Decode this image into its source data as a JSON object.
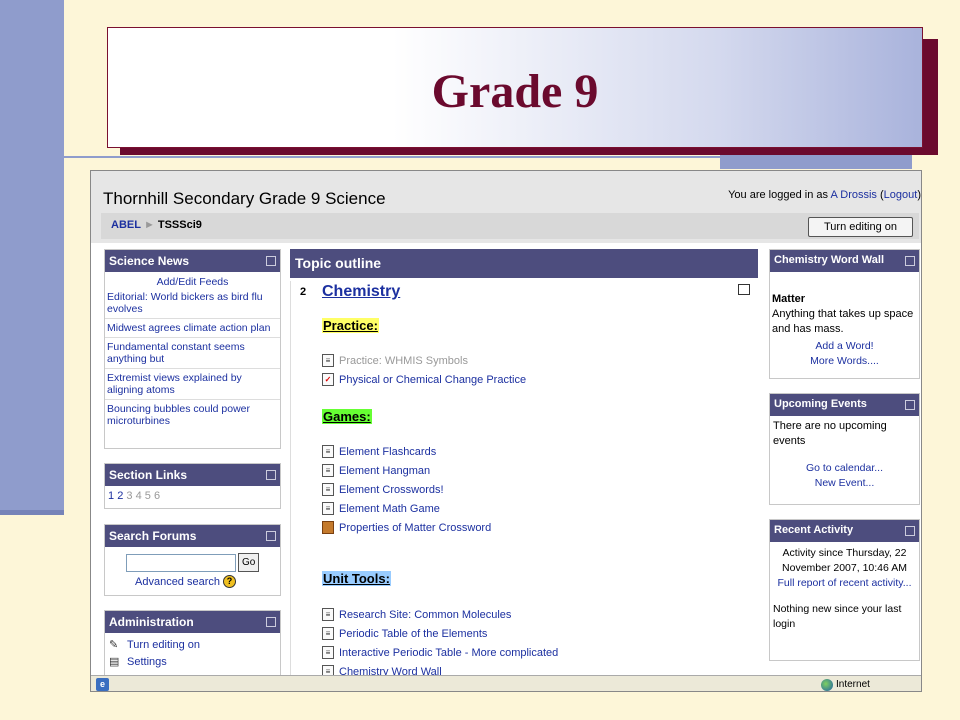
{
  "slide": {
    "title": "Grade 9"
  },
  "site": {
    "title": "Thornhill Secondary Grade 9 Science",
    "login_prefix": "You are logged in as ",
    "user": "A Drossis",
    "logout": "Logout",
    "breadcrumb": {
      "home": "ABEL",
      "separator": "►",
      "course": "TSSSci9"
    },
    "turn_editing_button": "Turn editing on"
  },
  "science_news": {
    "title": "Science News",
    "add_feeds": "Add/Edit Feeds",
    "items": [
      "Editorial: World bickers as bird flu evolves",
      "Midwest agrees climate action plan",
      "Fundamental constant seems anything but",
      "Extremist views explained by aligning atoms",
      "Bouncing bubbles could power microturbines"
    ]
  },
  "section_links": {
    "title": "Section Links",
    "active": [
      "1",
      "2"
    ],
    "inactive": [
      "3",
      "4",
      "5",
      "6"
    ]
  },
  "search_forums": {
    "title": "Search Forums",
    "go": "Go",
    "advanced": "Advanced search",
    "help": "?"
  },
  "administration": {
    "title": "Administration",
    "items": [
      "Turn editing on",
      "Settings"
    ]
  },
  "topic": {
    "title": "Topic outline",
    "section_number": "2",
    "section_title": "Chemistry",
    "practice_heading": "Practice:",
    "practice": [
      {
        "label": "Practice: WHMIS Symbols",
        "dim": true
      },
      {
        "label": "Physical or Chemical Change Practice",
        "dim": false
      }
    ],
    "games_heading": "Games:",
    "games": [
      "Element Flashcards",
      "Element Hangman",
      "Element Crosswords!",
      "Element Math Game",
      "Properties of Matter Crossword"
    ],
    "tools_heading": "Unit Tools:",
    "tools": [
      "Research Site: Common Molecules",
      "Periodic Table of the Elements",
      "Interactive Periodic Table - More complicated",
      "Chemistry Word Wall"
    ]
  },
  "word_wall": {
    "title": "Chemistry Word Wall",
    "word": "Matter",
    "definition": "Anything that takes up space and has mass.",
    "add": "Add a Word!",
    "more": "More Words...."
  },
  "events": {
    "title": "Upcoming Events",
    "empty": "There are no upcoming events",
    "calendar": "Go to calendar...",
    "new_event": "New Event..."
  },
  "recent": {
    "title": "Recent Activity",
    "since": "Activity since Thursday, 22 November 2007, 10:46 AM",
    "full_report": "Full report of recent activity...",
    "nothing": "Nothing new since your last login"
  },
  "status_bar": {
    "zone": "Internet"
  }
}
